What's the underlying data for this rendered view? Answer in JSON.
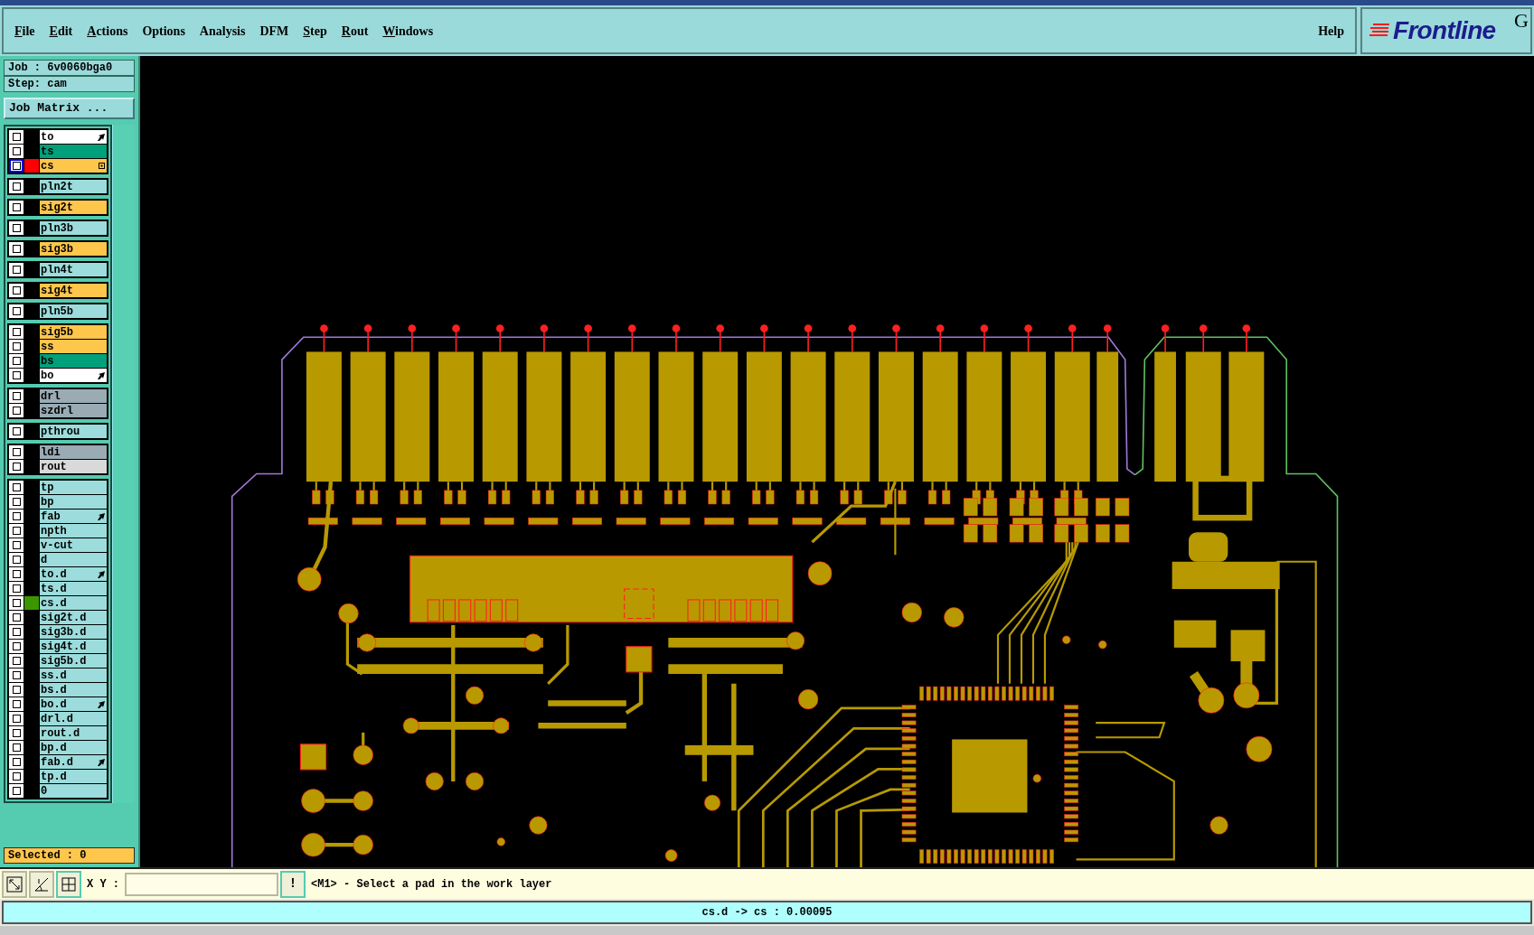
{
  "menu": [
    {
      "label": "File",
      "underlined": true
    },
    {
      "label": "Edit",
      "underlined": true
    },
    {
      "label": "Actions",
      "underlined": true
    },
    {
      "label": "Options",
      "underlined": false
    },
    {
      "label": "Analysis",
      "underlined": false
    },
    {
      "label": "DFM",
      "underlined": false
    },
    {
      "label": "Step",
      "underlined": true
    },
    {
      "label": "Rout",
      "underlined": true
    },
    {
      "label": "Windows",
      "underlined": true
    }
  ],
  "help": "Help",
  "logo": {
    "text": "Frontline",
    "suffix": "G"
  },
  "job": {
    "job": "Job : 6v0060bga0",
    "step": "Step: cam",
    "matrix_button": "Job Matrix ..."
  },
  "layer_groups": [
    {
      "layers": [
        {
          "name": "to",
          "color": "#ffffff",
          "kind": "arrow",
          "work": false
        },
        {
          "name": "ts",
          "color": "#00a07a",
          "kind": "plain",
          "work": false
        },
        {
          "name": "cs",
          "color": "#ffc64c",
          "kind": "grid",
          "work": true,
          "marker": {
            "color": "#ff0000"
          }
        }
      ]
    },
    {
      "layers": [
        {
          "name": "pln2t",
          "color": "#9cdcdc",
          "kind": "plain",
          "work": false
        }
      ]
    },
    {
      "layers": [
        {
          "name": "sig2t",
          "color": "#ffc64c",
          "kind": "plain",
          "work": false
        }
      ]
    },
    {
      "layers": [
        {
          "name": "pln3b",
          "color": "#9cdcdc",
          "kind": "plain",
          "work": false
        }
      ]
    },
    {
      "layers": [
        {
          "name": "sig3b",
          "color": "#ffc64c",
          "kind": "plain",
          "work": false
        }
      ]
    },
    {
      "layers": [
        {
          "name": "pln4t",
          "color": "#9cdcdc",
          "kind": "plain",
          "work": false
        }
      ]
    },
    {
      "layers": [
        {
          "name": "sig4t",
          "color": "#ffc64c",
          "kind": "plain",
          "work": false
        }
      ]
    },
    {
      "layers": [
        {
          "name": "pln5b",
          "color": "#9cdcdc",
          "kind": "plain",
          "work": false
        }
      ]
    },
    {
      "layers": [
        {
          "name": "sig5b",
          "color": "#ffc64c",
          "kind": "plain",
          "work": false
        },
        {
          "name": "ss",
          "color": "#ffc64c",
          "kind": "plain",
          "work": false
        },
        {
          "name": "bs",
          "color": "#00a07a",
          "kind": "plain",
          "work": false
        },
        {
          "name": "bo",
          "color": "#ffffff",
          "kind": "arrow",
          "work": false
        }
      ]
    },
    {
      "layers": [
        {
          "name": "drl",
          "color": "#9aabb4",
          "kind": "plain",
          "work": false
        },
        {
          "name": "szdrl",
          "color": "#9aabb4",
          "kind": "plain",
          "work": false
        }
      ]
    },
    {
      "layers": [
        {
          "name": "pthrou",
          "color": "#9cdcdc",
          "kind": "plain",
          "work": false
        }
      ]
    },
    {
      "layers": [
        {
          "name": "ldi",
          "color": "#9aabb4",
          "kind": "plain",
          "work": false
        },
        {
          "name": "rout",
          "color": "#d9d9d9",
          "kind": "plain",
          "work": false
        }
      ]
    },
    {
      "layers": [
        {
          "name": "tp",
          "color": "#9cdcdc",
          "kind": "plain",
          "work": false
        },
        {
          "name": "bp",
          "color": "#9cdcdc",
          "kind": "plain",
          "work": false
        },
        {
          "name": "fab",
          "color": "#9cdcdc",
          "kind": "arrow",
          "work": false
        },
        {
          "name": "npth",
          "color": "#9cdcdc",
          "kind": "plain",
          "work": false
        },
        {
          "name": "v-cut",
          "color": "#9cdcdc",
          "kind": "plain",
          "work": false
        },
        {
          "name": "d",
          "color": "#9cdcdc",
          "kind": "plain",
          "work": false
        },
        {
          "name": "to.d",
          "color": "#9cdcdc",
          "kind": "arrow",
          "work": false
        },
        {
          "name": "ts.d",
          "color": "#9cdcdc",
          "kind": "plain",
          "work": false
        },
        {
          "name": "cs.d",
          "color": "#9cdcdc",
          "kind": "plain",
          "work": false,
          "marker": {
            "color": "#3c9600"
          }
        },
        {
          "name": "sig2t.d",
          "color": "#9cdcdc",
          "kind": "plain",
          "work": false
        },
        {
          "name": "sig3b.d",
          "color": "#9cdcdc",
          "kind": "plain",
          "work": false
        },
        {
          "name": "sig4t.d",
          "color": "#9cdcdc",
          "kind": "plain",
          "work": false
        },
        {
          "name": "sig5b.d",
          "color": "#9cdcdc",
          "kind": "plain",
          "work": false
        },
        {
          "name": "ss.d",
          "color": "#9cdcdc",
          "kind": "plain",
          "work": false
        },
        {
          "name": "bs.d",
          "color": "#9cdcdc",
          "kind": "plain",
          "work": false
        },
        {
          "name": "bo.d",
          "color": "#9cdcdc",
          "kind": "arrow",
          "work": false
        },
        {
          "name": "drl.d",
          "color": "#9cdcdc",
          "kind": "plain",
          "work": false
        },
        {
          "name": "rout.d",
          "color": "#9cdcdc",
          "kind": "plain",
          "work": false
        },
        {
          "name": "bp.d",
          "color": "#9cdcdc",
          "kind": "plain",
          "work": false
        },
        {
          "name": "fab.d",
          "color": "#9cdcdc",
          "kind": "arrow",
          "work": false
        },
        {
          "name": "tp.d",
          "color": "#9cdcdc",
          "kind": "plain",
          "work": false
        },
        {
          "name": "0",
          "color": "#9cdcdc",
          "kind": "plain",
          "work": false
        }
      ]
    }
  ],
  "selected_count": "Selected : 0",
  "toolbar": {
    "tools": [
      {
        "selected": false
      },
      {
        "selected": false
      },
      {
        "selected": true
      }
    ],
    "xy_label": "X Y :",
    "alert_button": "!",
    "message": "<M1> - Select a pad in the work layer"
  },
  "status": "cs.d -> cs : 0.00095"
}
